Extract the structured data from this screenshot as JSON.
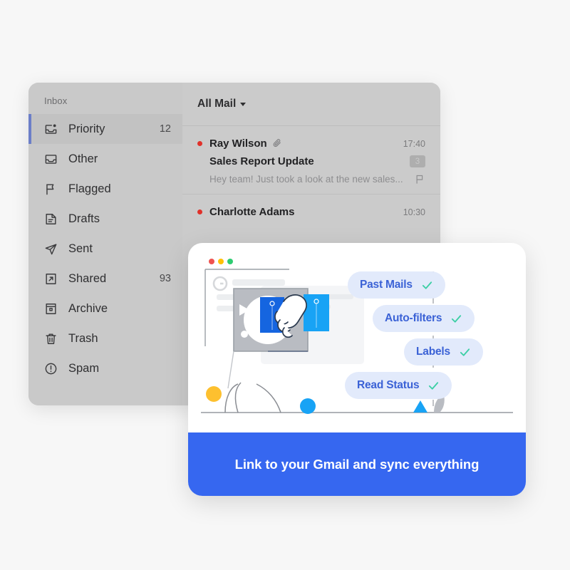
{
  "window": {
    "sidebar": {
      "title": "Inbox",
      "items": [
        {
          "label": "Priority",
          "count": "12",
          "icon": "inbox-dot-icon",
          "selected": true
        },
        {
          "label": "Other",
          "count": "",
          "icon": "inbox-icon",
          "selected": false
        },
        {
          "label": "Flagged",
          "count": "",
          "icon": "flag-icon",
          "selected": false
        },
        {
          "label": "Drafts",
          "count": "",
          "icon": "document-icon",
          "selected": false
        },
        {
          "label": "Sent",
          "count": "",
          "icon": "paper-plane-icon",
          "selected": false
        },
        {
          "label": "Shared",
          "count": "93",
          "icon": "share-box-icon",
          "selected": false
        },
        {
          "label": "Archive",
          "count": "",
          "icon": "archive-icon",
          "selected": false
        },
        {
          "label": "Trash",
          "count": "",
          "icon": "trash-icon",
          "selected": false
        },
        {
          "label": "Spam",
          "count": "",
          "icon": "alert-circle-icon",
          "selected": false
        }
      ]
    },
    "list": {
      "filter_label": "All Mail",
      "messages": [
        {
          "sender": "Ray Wilson",
          "time": "17:40",
          "subject": "Sales Report Update",
          "preview": "Hey team! Just took a look at the new sales...",
          "badge": "3",
          "has_attachment": true,
          "unread": true,
          "flagged": true
        },
        {
          "sender": "Charlotte Adams",
          "time": "10:30",
          "subject": "",
          "preview": "",
          "badge": "",
          "has_attachment": false,
          "unread": true,
          "flagged": false
        }
      ]
    }
  },
  "promo": {
    "pills": [
      {
        "label": "Past Mails",
        "checked": true
      },
      {
        "label": "Auto-filters",
        "checked": true
      },
      {
        "label": "Labels",
        "checked": true
      },
      {
        "label": "Read Status",
        "checked": true
      }
    ],
    "cta_label": "Link to your Gmail and sync everything"
  },
  "colors": {
    "page_background": "#f7f7f7",
    "window_background": "#c9c9c9",
    "list_background": "#cbcbcb",
    "selected_row": "#c2c2c2",
    "selection_indicator": "#6b7ec8",
    "unread_dot": "#e0312a",
    "card_background": "#ffffff",
    "pill_background": "#e2eafb",
    "pill_text": "#3b62d6",
    "check_mark": "#3ccfa5",
    "cta_background": "#3667f0",
    "cta_text": "#ffffff"
  }
}
